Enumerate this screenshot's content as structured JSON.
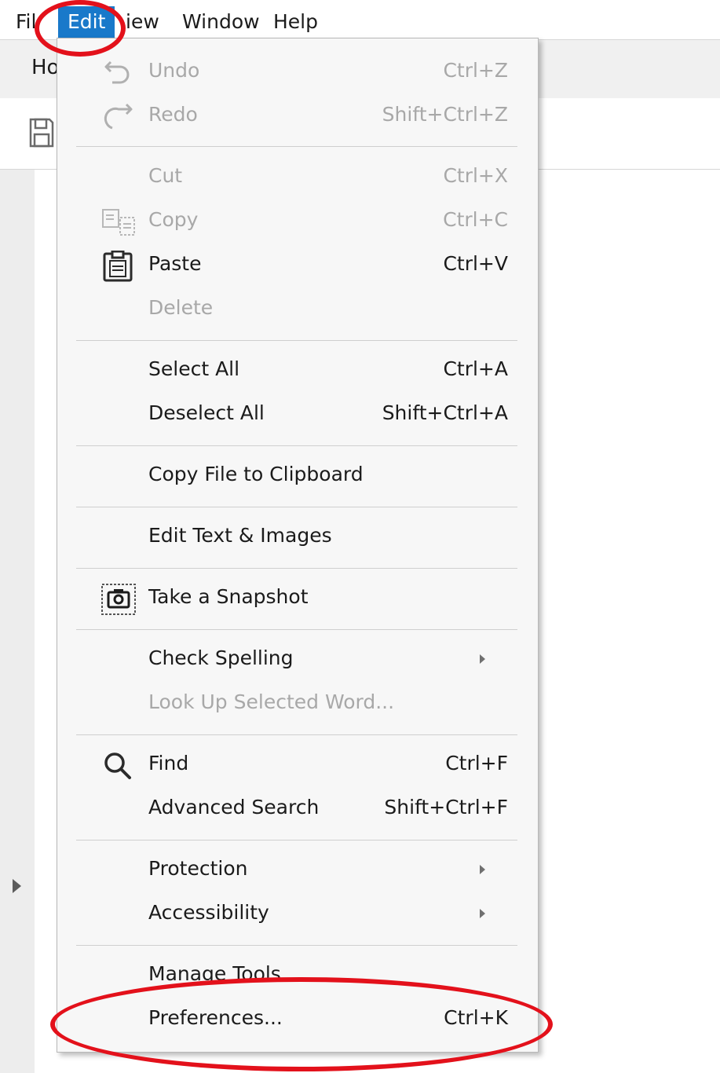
{
  "menubar": {
    "items": [
      {
        "label": "File",
        "visible_text": "Fil"
      },
      {
        "label": "Edit"
      },
      {
        "label": "View",
        "visible_text": "iew"
      },
      {
        "label": "Window"
      },
      {
        "label": "Help"
      }
    ]
  },
  "window": {
    "tab_visible_text": "Ho"
  },
  "edit_menu": {
    "items": [
      {
        "label": "Undo",
        "shortcut": "Ctrl+Z",
        "enabled": false,
        "icon": "undo-icon"
      },
      {
        "label": "Redo",
        "shortcut": "Shift+Ctrl+Z",
        "enabled": false,
        "icon": "redo-icon"
      },
      {
        "label": "Cut",
        "shortcut": "Ctrl+X",
        "enabled": false
      },
      {
        "label": "Copy",
        "shortcut": "Ctrl+C",
        "enabled": false,
        "icon": "copy-icon"
      },
      {
        "label": "Paste",
        "shortcut": "Ctrl+V",
        "enabled": true,
        "icon": "clipboard-icon"
      },
      {
        "label": "Delete",
        "shortcut": "",
        "enabled": false
      },
      {
        "label": "Select All",
        "shortcut": "Ctrl+A",
        "enabled": true
      },
      {
        "label": "Deselect All",
        "shortcut": "Shift+Ctrl+A",
        "enabled": true
      },
      {
        "label": "Copy File to Clipboard",
        "shortcut": "",
        "enabled": true
      },
      {
        "label": "Edit Text & Images",
        "shortcut": "",
        "enabled": true
      },
      {
        "label": "Take a Snapshot",
        "shortcut": "",
        "enabled": true,
        "icon": "camera-icon"
      },
      {
        "label": "Check Spelling",
        "shortcut": "",
        "enabled": true,
        "submenu": true
      },
      {
        "label": "Look Up Selected Word...",
        "shortcut": "",
        "enabled": false
      },
      {
        "label": "Find",
        "shortcut": "Ctrl+F",
        "enabled": true,
        "icon": "search-icon"
      },
      {
        "label": "Advanced Search",
        "shortcut": "Shift+Ctrl+F",
        "enabled": true
      },
      {
        "label": "Protection",
        "shortcut": "",
        "enabled": true,
        "submenu": true
      },
      {
        "label": "Accessibility",
        "shortcut": "",
        "enabled": true,
        "submenu": true
      },
      {
        "label": "Manage Tools",
        "shortcut": "",
        "enabled": true
      },
      {
        "label": "Preferences...",
        "shortcut": "Ctrl+K",
        "enabled": true
      }
    ]
  },
  "colors": {
    "menubar_active": "#1979ca",
    "annotation": "#e3111b",
    "disabled_text": "#a8a8a8"
  }
}
